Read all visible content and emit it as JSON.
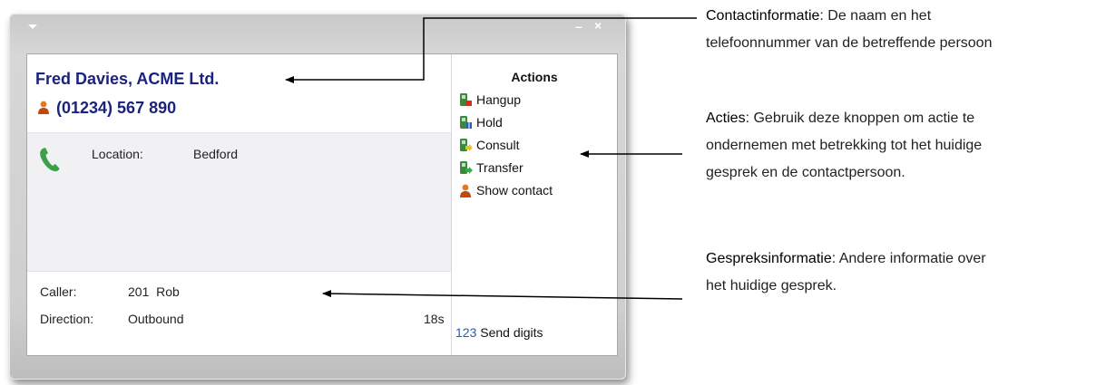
{
  "window": {
    "title": ""
  },
  "contact": {
    "name": "Fred Davies, ACME Ltd.",
    "phone": "(01234) 567 890"
  },
  "info": {
    "location_label": "Location:",
    "location_value": "Bedford"
  },
  "call": {
    "caller_label": "Caller:",
    "caller_value": "201  Rob",
    "direction_label": "Direction:",
    "direction_value": "Outbound",
    "duration": "18s"
  },
  "actions": {
    "title": "Actions",
    "items": [
      {
        "label": "Hangup",
        "icon": "hangup-icon"
      },
      {
        "label": "Hold",
        "icon": "hold-icon"
      },
      {
        "label": "Consult",
        "icon": "consult-icon"
      },
      {
        "label": "Transfer",
        "icon": "transfer-icon"
      },
      {
        "label": "Show contact",
        "icon": "show-contact-icon"
      }
    ],
    "send_digits_icon": "123",
    "send_digits": "Send digits"
  },
  "annotations": [
    {
      "title": "Contactinformatie",
      "line1": ": De naam en het",
      "line2": "telefoonnummer van de betreffende persoon"
    },
    {
      "title": "Acties",
      "line1": ": Gebruik deze knoppen om actie te",
      "line2": "ondernemen met betrekking tot het huidige",
      "line3": "gesprek en de contactpersoon."
    },
    {
      "title": "Gespreksinformatie",
      "line1": ": Andere informatie over",
      "line2": "het huidige gesprek."
    }
  ],
  "colors": {
    "name_blue": "#1a237e",
    "annotation_title": "#000000"
  }
}
